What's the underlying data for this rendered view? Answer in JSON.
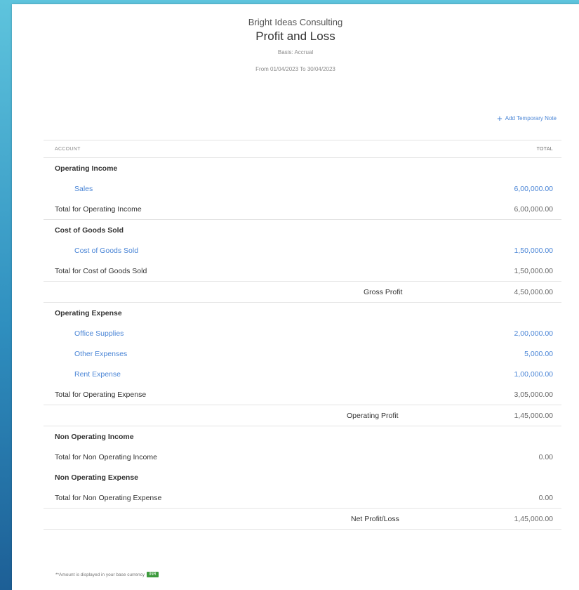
{
  "report": {
    "company": "Bright Ideas Consulting",
    "title": "Profit and Loss",
    "basis": "Basis: Accrual",
    "date_range": "From 01/04/2023 To 30/04/2023",
    "add_note": "Add Temporary Note"
  },
  "table": {
    "col_account": "ACCOUNT",
    "col_total": "TOTAL",
    "operating_income": {
      "heading": "Operating Income",
      "items": [
        {
          "label": "Sales",
          "value": "6,00,000.00"
        }
      ],
      "total_label": "Total for Operating Income",
      "total_value": "6,00,000.00"
    },
    "cogs": {
      "heading": "Cost of Goods Sold",
      "items": [
        {
          "label": "Cost of Goods Sold",
          "value": "1,50,000.00"
        }
      ],
      "total_label": "Total for Cost of Goods Sold",
      "total_value": "1,50,000.00"
    },
    "gross_profit": {
      "label": "Gross Profit",
      "value": "4,50,000.00"
    },
    "operating_expense": {
      "heading": "Operating Expense",
      "items": [
        {
          "label": "Office Supplies",
          "value": "2,00,000.00"
        },
        {
          "label": "Other Expenses",
          "value": "5,000.00"
        },
        {
          "label": "Rent Expense",
          "value": "1,00,000.00"
        }
      ],
      "total_label": "Total for Operating Expense",
      "total_value": "3,05,000.00"
    },
    "operating_profit": {
      "label": "Operating Profit",
      "value": "1,45,000.00"
    },
    "non_operating_income": {
      "heading": "Non Operating Income",
      "total_label": "Total for Non Operating Income",
      "total_value": "0.00"
    },
    "non_operating_expense": {
      "heading": "Non Operating Expense",
      "total_label": "Total for Non Operating Expense",
      "total_value": "0.00"
    },
    "net_profit": {
      "label": "Net Profit/Loss",
      "value": "1,45,000.00"
    }
  },
  "footnote": {
    "text": "**Amount is displayed in your base currency",
    "badge": "INR"
  }
}
